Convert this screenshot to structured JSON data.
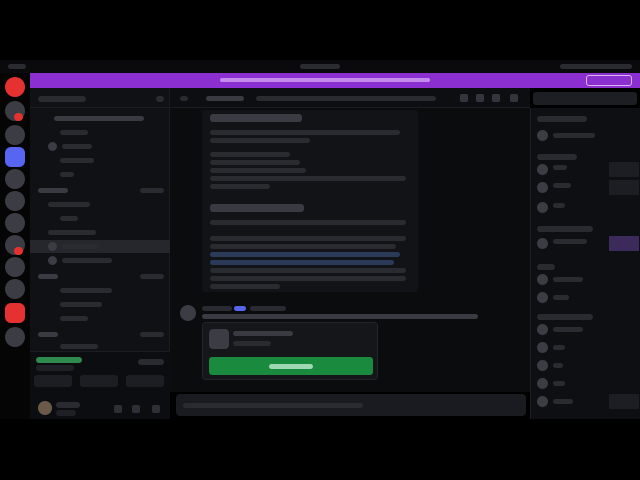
{
  "colors": {
    "accent": "#8b2fd0",
    "green": "#1a8a3e",
    "badge_red": "#e5312f"
  },
  "layout_sections": [
    "top-bar",
    "server-rail",
    "channel-list",
    "chat",
    "member-list"
  ]
}
